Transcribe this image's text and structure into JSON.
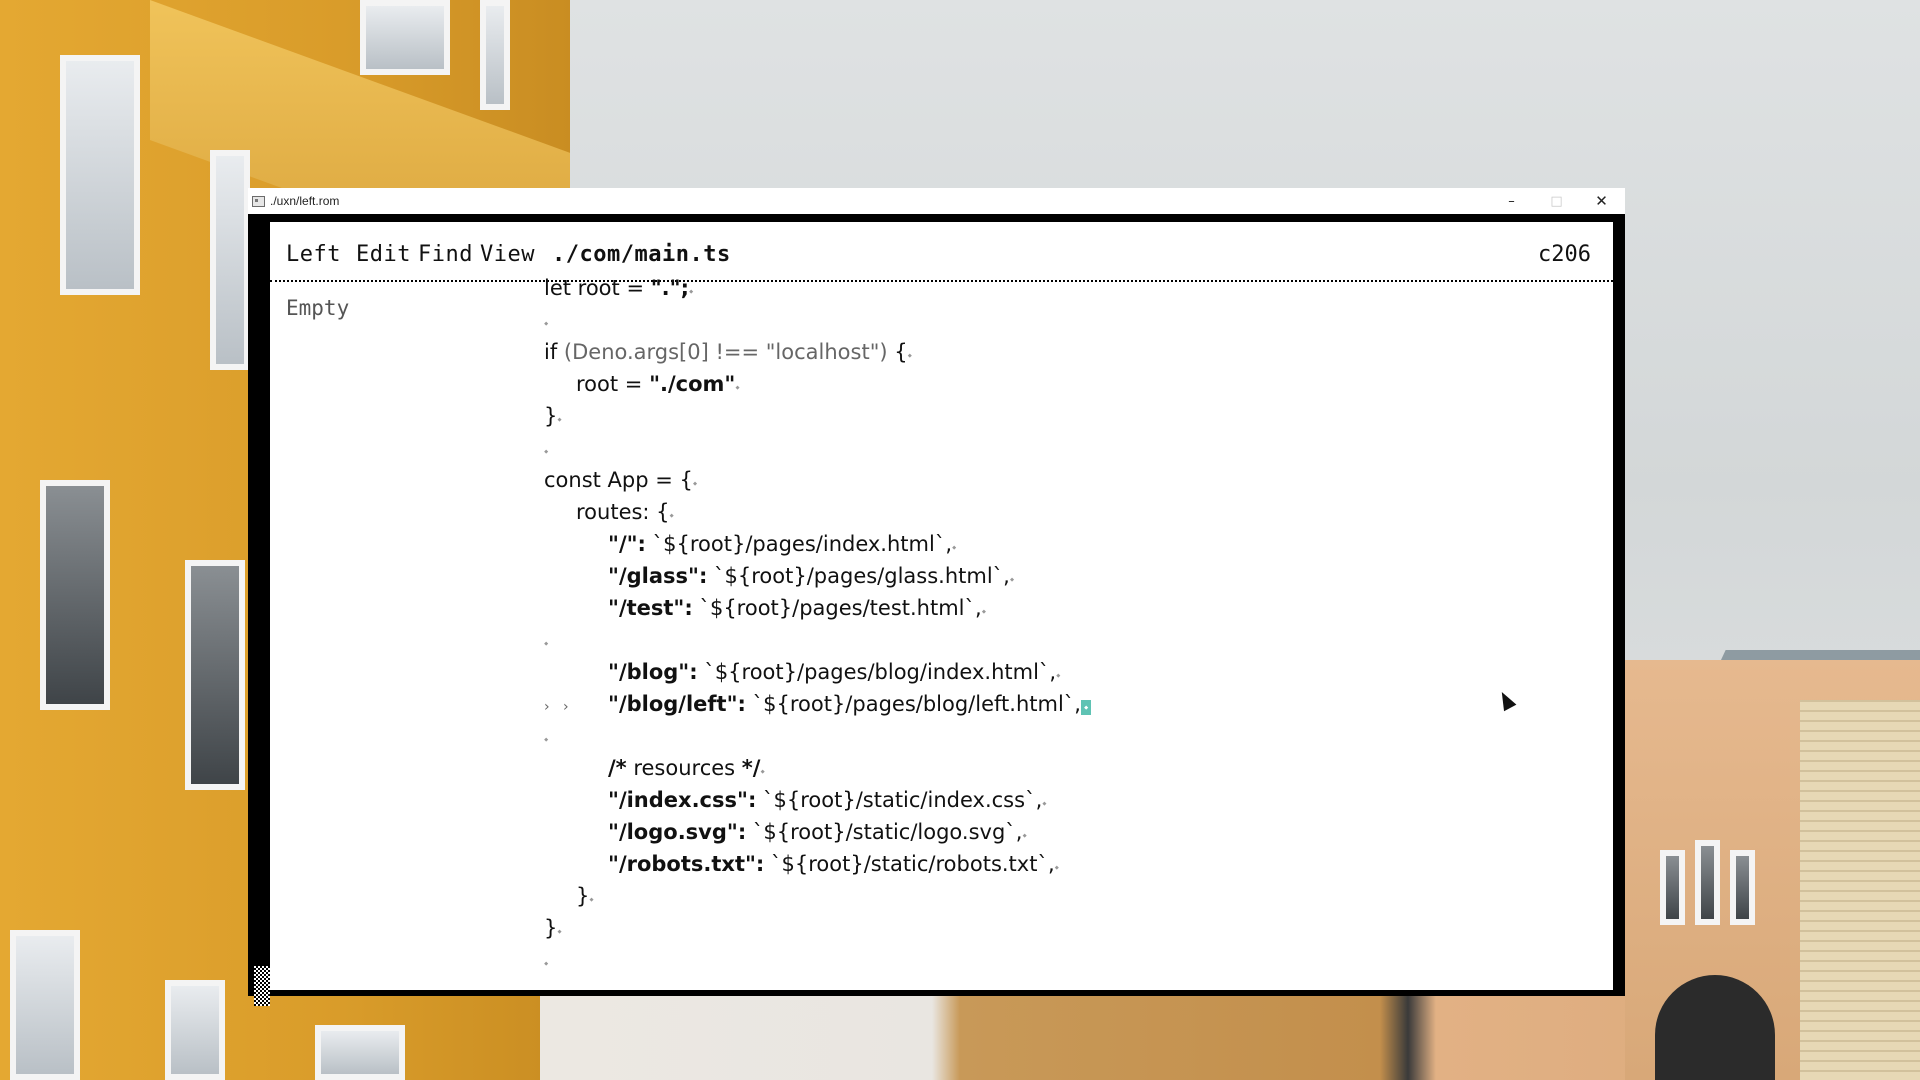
{
  "window": {
    "title": "./uxn/left.rom",
    "minimize_glyph": "–",
    "maximize_glyph": "□",
    "close_glyph": "✕"
  },
  "menubar": {
    "marker": "◆",
    "items": [
      "Left",
      "Edit",
      "Find",
      "View"
    ],
    "file_path": "./com/main.ts",
    "counter": "c206"
  },
  "sidebar": {
    "label": "Empty"
  },
  "editor": {
    "newline_marker": "⬩",
    "tab_marker": "›",
    "lines": [
      "let root = \".\";",
      "",
      "if (Deno.args[0] !== \"localhost\") {",
      "  root = \"./com\"",
      "}",
      "",
      "const App = {",
      "  routes: {",
      "    \"/\": `${root}/pages/index.html`,",
      "    \"/glass\": `${root}/pages/glass.html`,",
      "    \"/test\": `${root}/pages/test.html`,",
      "",
      "    \"/blog\": `${root}/pages/blog/index.html`,",
      "    \"/blog/left\": `${root}/pages/blog/left.html`,",
      "",
      "    /* resources */",
      "    \"/index.css\": `${root}/static/index.css`,",
      "    \"/logo.svg\": `${root}/static/logo.svg`,",
      "    \"/robots.txt\": `${root}/static/robots.txt`,",
      "  }",
      "}",
      ""
    ]
  }
}
